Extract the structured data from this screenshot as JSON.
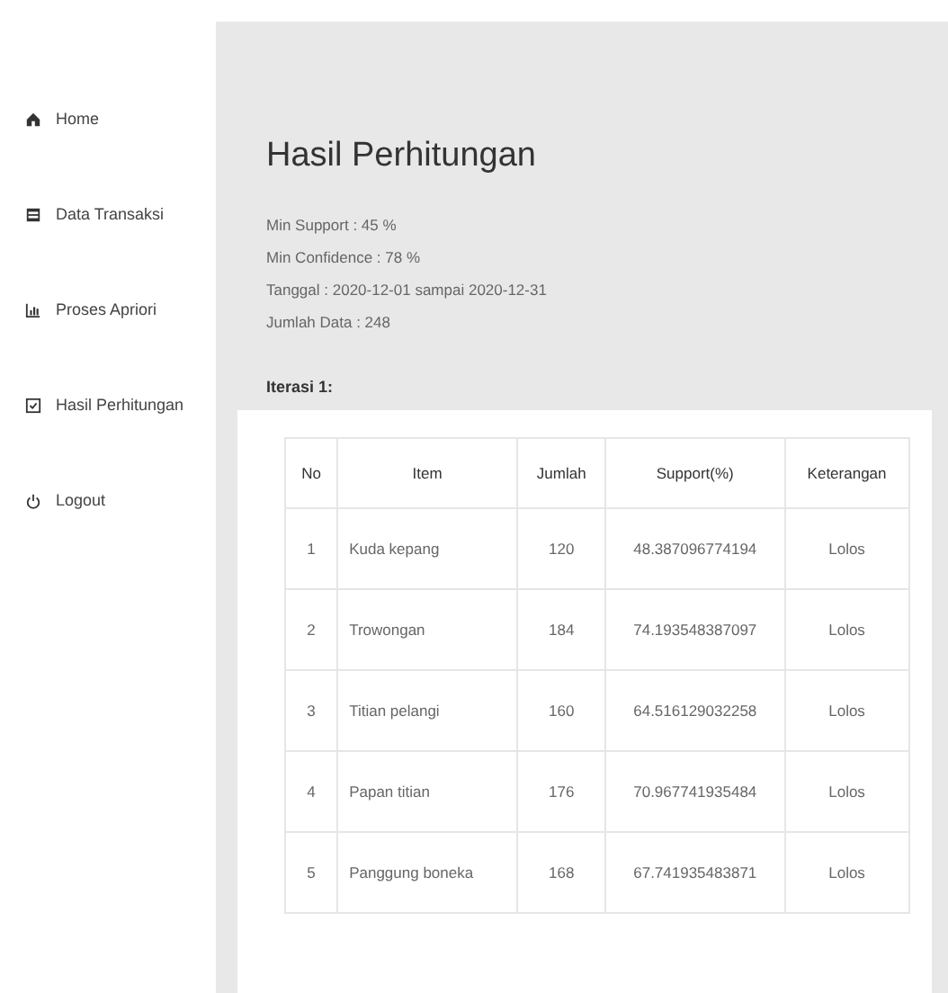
{
  "sidebar": {
    "items": [
      {
        "label": "Home",
        "kind": "home"
      },
      {
        "label": "Data Transaksi",
        "kind": "table"
      },
      {
        "label": "Proses Apriori",
        "kind": "chart"
      },
      {
        "label": "Hasil Perhitungan",
        "kind": "check"
      },
      {
        "label": "Logout",
        "kind": "power"
      }
    ]
  },
  "page_title": "Hasil Perhitungan",
  "info": [
    "Min Support : 45 %",
    "Min Confidence : 78 %",
    "Tanggal : 2020-12-01 sampai 2020-12-31",
    "Jumlah Data : 248"
  ],
  "section_title": "Iterasi 1:",
  "table": {
    "columns": [
      "No",
      "Item",
      "Jumlah",
      "Support(%)",
      "Keterangan"
    ],
    "rows": [
      [
        "1",
        "Kuda kepang",
        "120",
        "48.387096774194",
        "Lolos"
      ],
      [
        "2",
        "Trowongan",
        "184",
        "74.193548387097",
        "Lolos"
      ],
      [
        "3",
        "Titian pelangi",
        "160",
        "64.516129032258",
        "Lolos"
      ],
      [
        "4",
        "Papan titian",
        "176",
        "70.967741935484",
        "Lolos"
      ],
      [
        "5",
        "Panggung boneka",
        "168",
        "67.741935483871",
        "Lolos"
      ]
    ]
  }
}
